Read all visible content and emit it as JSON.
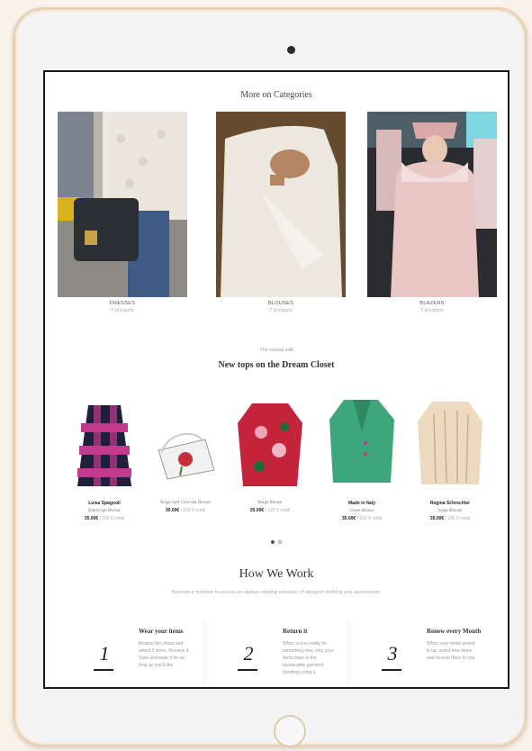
{
  "categories_section": {
    "title": "More on Categories",
    "items": [
      {
        "name": "DRESSES",
        "count": "7 products",
        "image": "bag-photo"
      },
      {
        "name": "BLOUSES",
        "count": "7 products",
        "image": "blouse-photo"
      },
      {
        "name": "BLAZERS",
        "count": "2 products",
        "image": "coat-photo"
      }
    ]
  },
  "tops_section": {
    "eyebrow": "The casual edit",
    "title": "New tops on the Dream Closet",
    "products": [
      {
        "brand": "Luisa Spagnoli",
        "name": "Blackvign Blouse",
        "price": "35.00€",
        "old_price": "/ 165 € retail",
        "image": "pink-check-coat"
      },
      {
        "brand": "",
        "name": "Beige Soft Chocolat Blouse",
        "price": "30.00€",
        "old_price": "/ 169 € retail",
        "image": "white-rose-bag"
      },
      {
        "brand": "",
        "name": "Beige Blouse",
        "price": "25.00€",
        "old_price": "/ 125 € retail",
        "image": "red-floral-sweater"
      },
      {
        "brand": "Made in Italy",
        "name": "Green Blouse",
        "price": "35.00€",
        "old_price": "/ 150 € retail",
        "image": "green-jacket"
      },
      {
        "brand": "Regina Schrechter",
        "name": "beige Blouse",
        "price": "35.00€",
        "old_price": "/ 165 € retail",
        "image": "beige-shirt"
      }
    ],
    "pagination": {
      "pages": 2,
      "active": 1
    }
  },
  "how_section": {
    "title": "How We Work",
    "subtitle": "Become a member to access an always-rotating selection of designer clothing and accessories.",
    "steps": [
      {
        "number": "1",
        "title": "Wear your items",
        "text": "Browse the closet and select 3 items. Receive it, Style and wear it for as long as you'd like."
      },
      {
        "number": "2",
        "title": "Return it",
        "text": "When you're ready for something new, ship your items back in the sustainable garment bundling using a"
      },
      {
        "number": "3",
        "title": "Renew every Month",
        "text": "When your rental period is up, select new items and receive them to you"
      }
    ]
  },
  "colors": {
    "frame_gold": "#e8d2b6",
    "screen_border": "#1a1a1a",
    "text_dark": "#333333",
    "text_muted": "#aaaaaa"
  }
}
